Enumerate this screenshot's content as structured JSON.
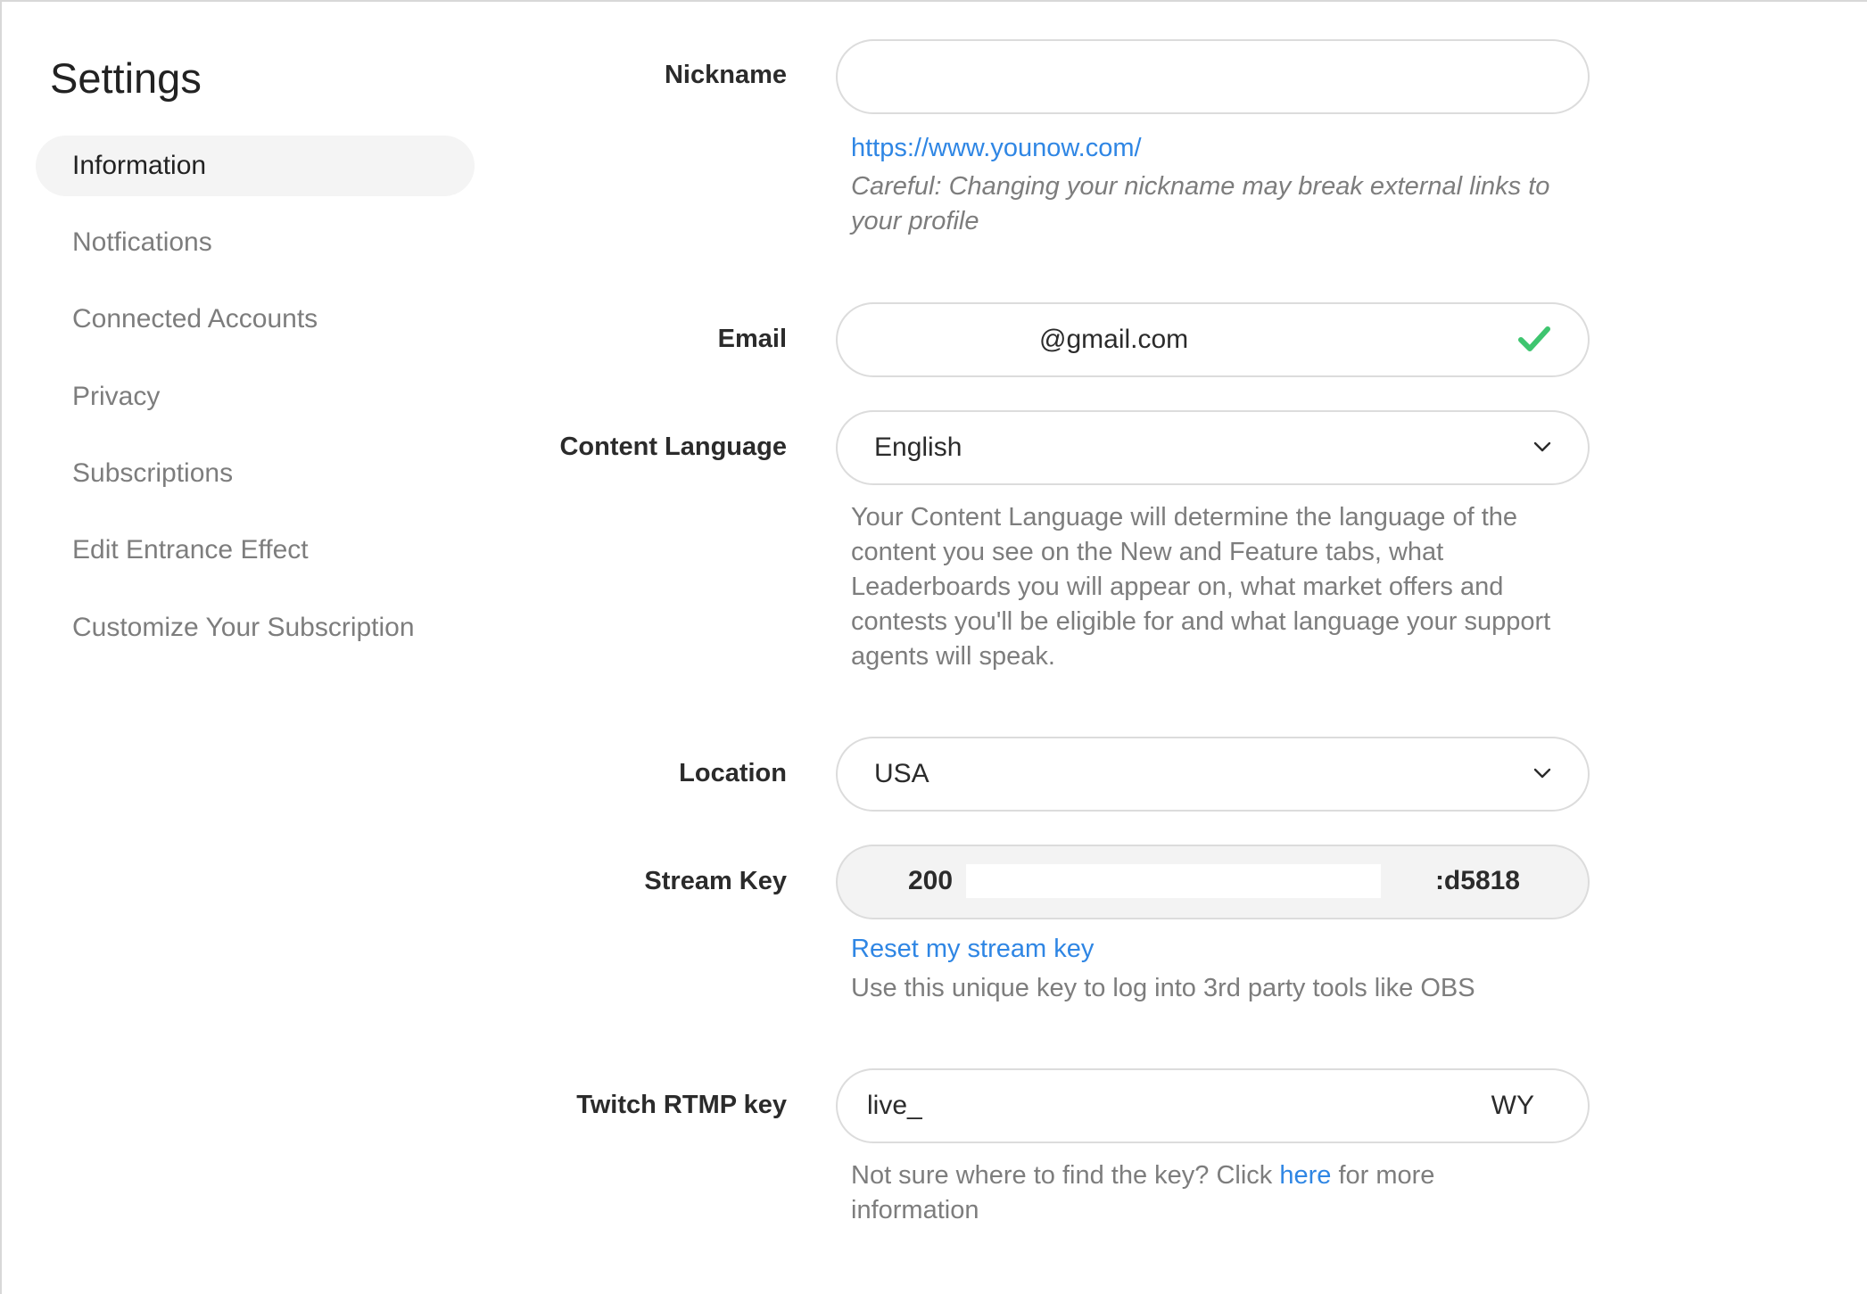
{
  "sidebar": {
    "title": "Settings",
    "items": [
      {
        "label": "Information"
      },
      {
        "label": "Notfications"
      },
      {
        "label": "Connected Accounts"
      },
      {
        "label": "Privacy"
      },
      {
        "label": "Subscriptions"
      },
      {
        "label": "Edit Entrance Effect"
      },
      {
        "label": "Customize Your Subscription"
      }
    ]
  },
  "form": {
    "nickname": {
      "label": "Nickname",
      "value": "",
      "profile_url": "https://www.younow.com/",
      "warning": "Careful: Changing your nickname may break external links to your profile"
    },
    "email": {
      "label": "Email",
      "value": "@gmail.com",
      "status_icon": "check-icon"
    },
    "content_language": {
      "label": "Content Language",
      "selected": "English",
      "help": "Your Content Language will determine the language of the content you see on the New and Feature tabs, what Leaderboards you will appear on, what market offers and contests you'll be eligible for and what language your support agents will speak."
    },
    "location": {
      "label": "Location",
      "selected": "USA"
    },
    "stream_key": {
      "label": "Stream Key",
      "value_start": "200",
      "value_end": ":d5818",
      "reset_link": "Reset my stream key",
      "help": "Use this unique key to log into 3rd party tools like OBS"
    },
    "twitch": {
      "label": "Twitch RTMP key",
      "value_start": "live_",
      "value_end": "WY",
      "help_prefix": "Not sure where to find the key? Click",
      "help_link": "here",
      "help_suffix": "for more information"
    }
  },
  "colors": {
    "accent": "#2f86e4",
    "success": "#3ec56f",
    "muted_text": "#7d7d7d"
  }
}
